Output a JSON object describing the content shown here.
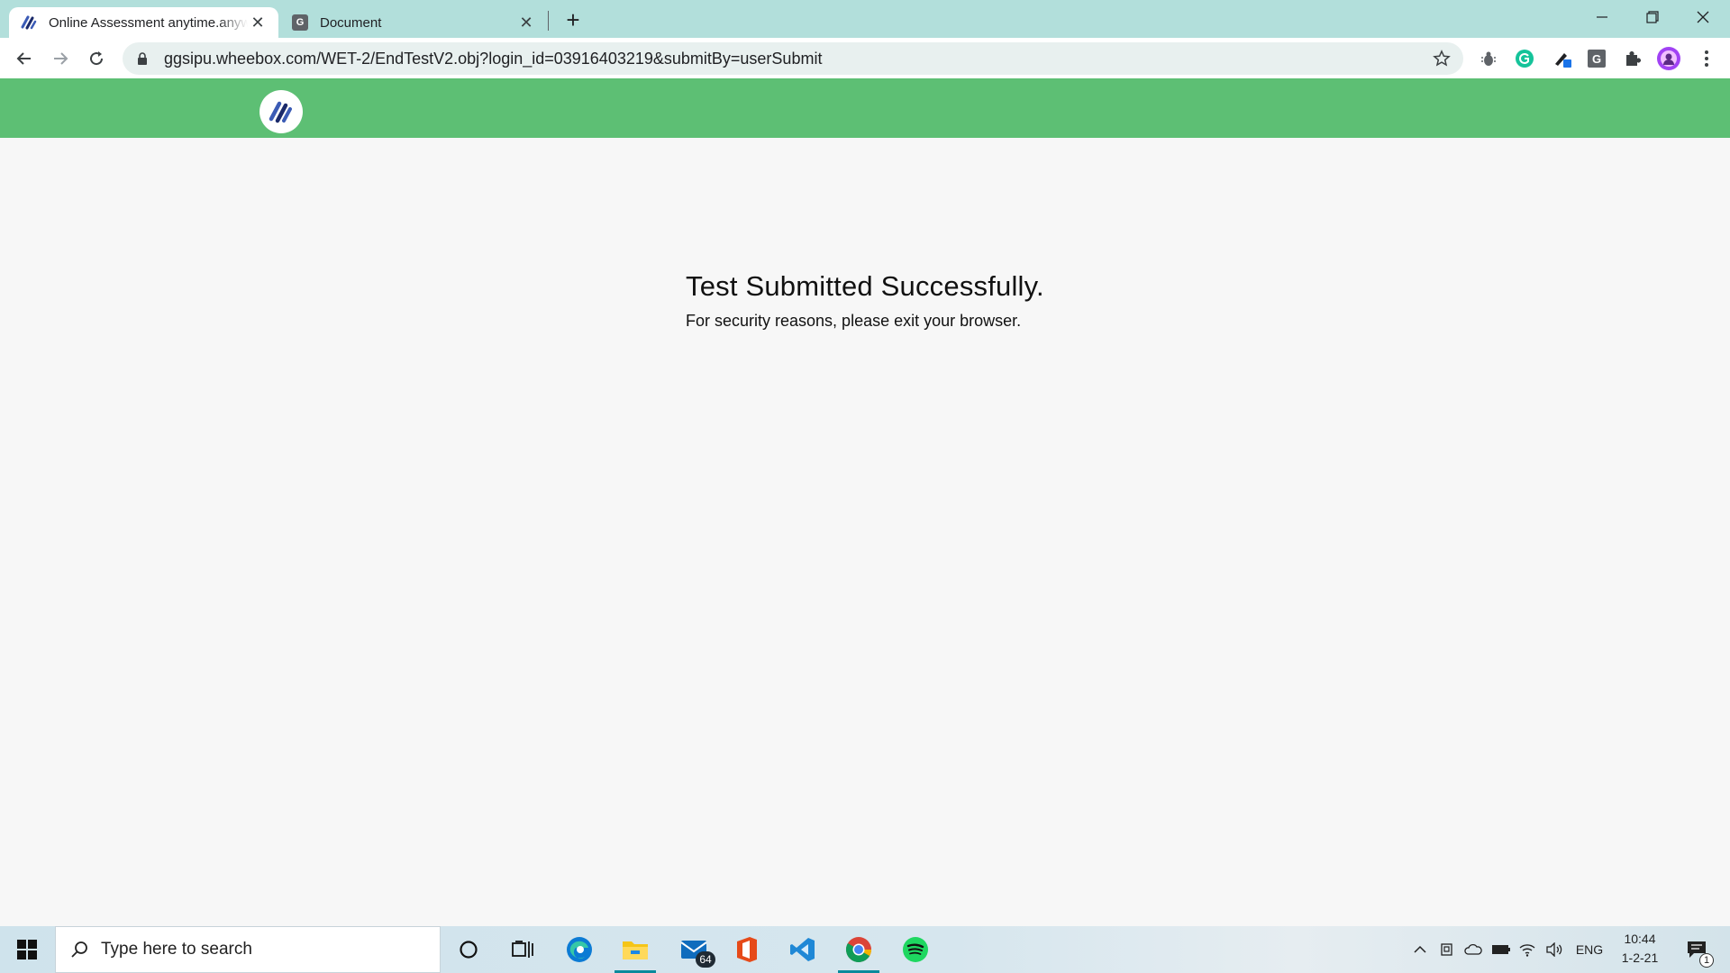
{
  "browser": {
    "tabs": [
      {
        "title": "Online Assessment anytime.anywhere",
        "favicon": "wheebox-icon",
        "active": true
      },
      {
        "title": "Document",
        "favicon": "document-icon",
        "favicon_letter": "G",
        "active": false
      }
    ],
    "address_bar": {
      "url": "ggsipu.wheebox.com/WET-2/EndTestV2.obj?login_id=03916403219&submitBy=userSubmit"
    }
  },
  "page": {
    "header_color": "#5dbf74",
    "title": "Test Submitted Successfully.",
    "subtitle": "For security reasons, please exit your browser."
  },
  "taskbar": {
    "search_placeholder": "Type here to search",
    "mail_badge": "64",
    "tray_language": "ENG",
    "clock_time": "10:44",
    "clock_date": "1-2-21",
    "notification_count": "1"
  }
}
